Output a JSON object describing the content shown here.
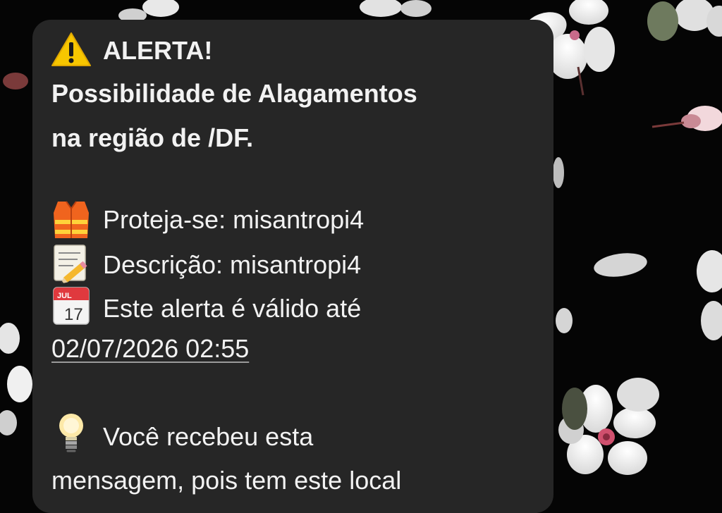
{
  "alert": {
    "title": "ALERTA!",
    "headline_line1": "Possibilidade de Alagamentos",
    "headline_line2": "na região de /DF.",
    "protect_label": "Proteja-se: misantropi4",
    "description_label": "Descrição: misantropi4",
    "validity_label": "Este alerta é válido até",
    "validity_date": "02/07/2026 02:55",
    "info_line1": "Você recebeu esta",
    "info_line2": "mensagem, pois tem este local",
    "calendar_month": "JUL",
    "calendar_day": "17"
  },
  "icons": {
    "title": "warning-icon",
    "protect": "safety-vest-icon",
    "description": "memo-pencil-icon",
    "validity": "calendar-icon",
    "info": "lightbulb-icon"
  },
  "colors": {
    "bubble": "#262626",
    "text": "#f2f2f2",
    "wallpaper": "#050505",
    "warning": "#f7c600",
    "vest": "#f0641e"
  }
}
